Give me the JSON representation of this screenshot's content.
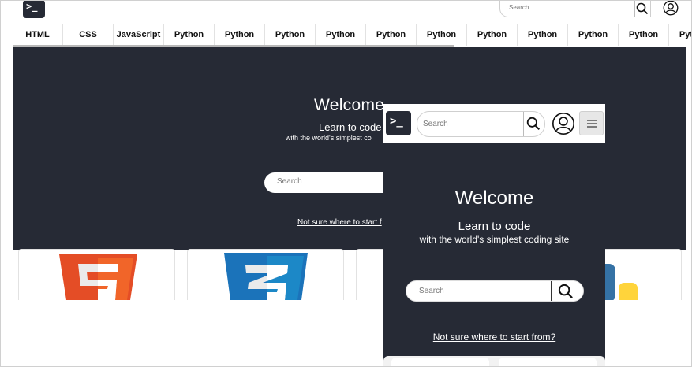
{
  "header": {
    "logo_glyph": ">_",
    "search_placeholder": "Search",
    "icons": [
      "terminal-logo-icon",
      "search-icon",
      "user-account-icon"
    ]
  },
  "tabs": [
    {
      "label": "HTML"
    },
    {
      "label": "CSS"
    },
    {
      "label": "JavaScript"
    },
    {
      "label": "Python"
    },
    {
      "label": "Python"
    },
    {
      "label": "Python"
    },
    {
      "label": "Python"
    },
    {
      "label": "Python"
    },
    {
      "label": "Python"
    },
    {
      "label": "Python"
    },
    {
      "label": "Python"
    },
    {
      "label": "Python"
    },
    {
      "label": "Python"
    },
    {
      "label": "Python"
    }
  ],
  "hero": {
    "title": "Welcome",
    "subtitle": "Learn to code",
    "tagline": "with the world's simplest co",
    "search_placeholder": "Search",
    "link": "Not sure where to start f"
  },
  "cards": [
    {
      "name": "html5-logo"
    },
    {
      "name": "css3-logo"
    },
    {
      "name": "python-logo"
    }
  ],
  "mobile": {
    "logo_glyph": ">_",
    "search_placeholder": "Search",
    "title": "Welcome",
    "subtitle": "Learn to code",
    "tagline": "with the world's simplest coding site",
    "search_placeholder2": "Search",
    "link": "Not sure where to start from?"
  },
  "colors": {
    "hero_bg": "#262a35",
    "html_orange": "#e44d26",
    "css_blue": "#1b73ba",
    "python_yellow": "#ffd43b"
  }
}
